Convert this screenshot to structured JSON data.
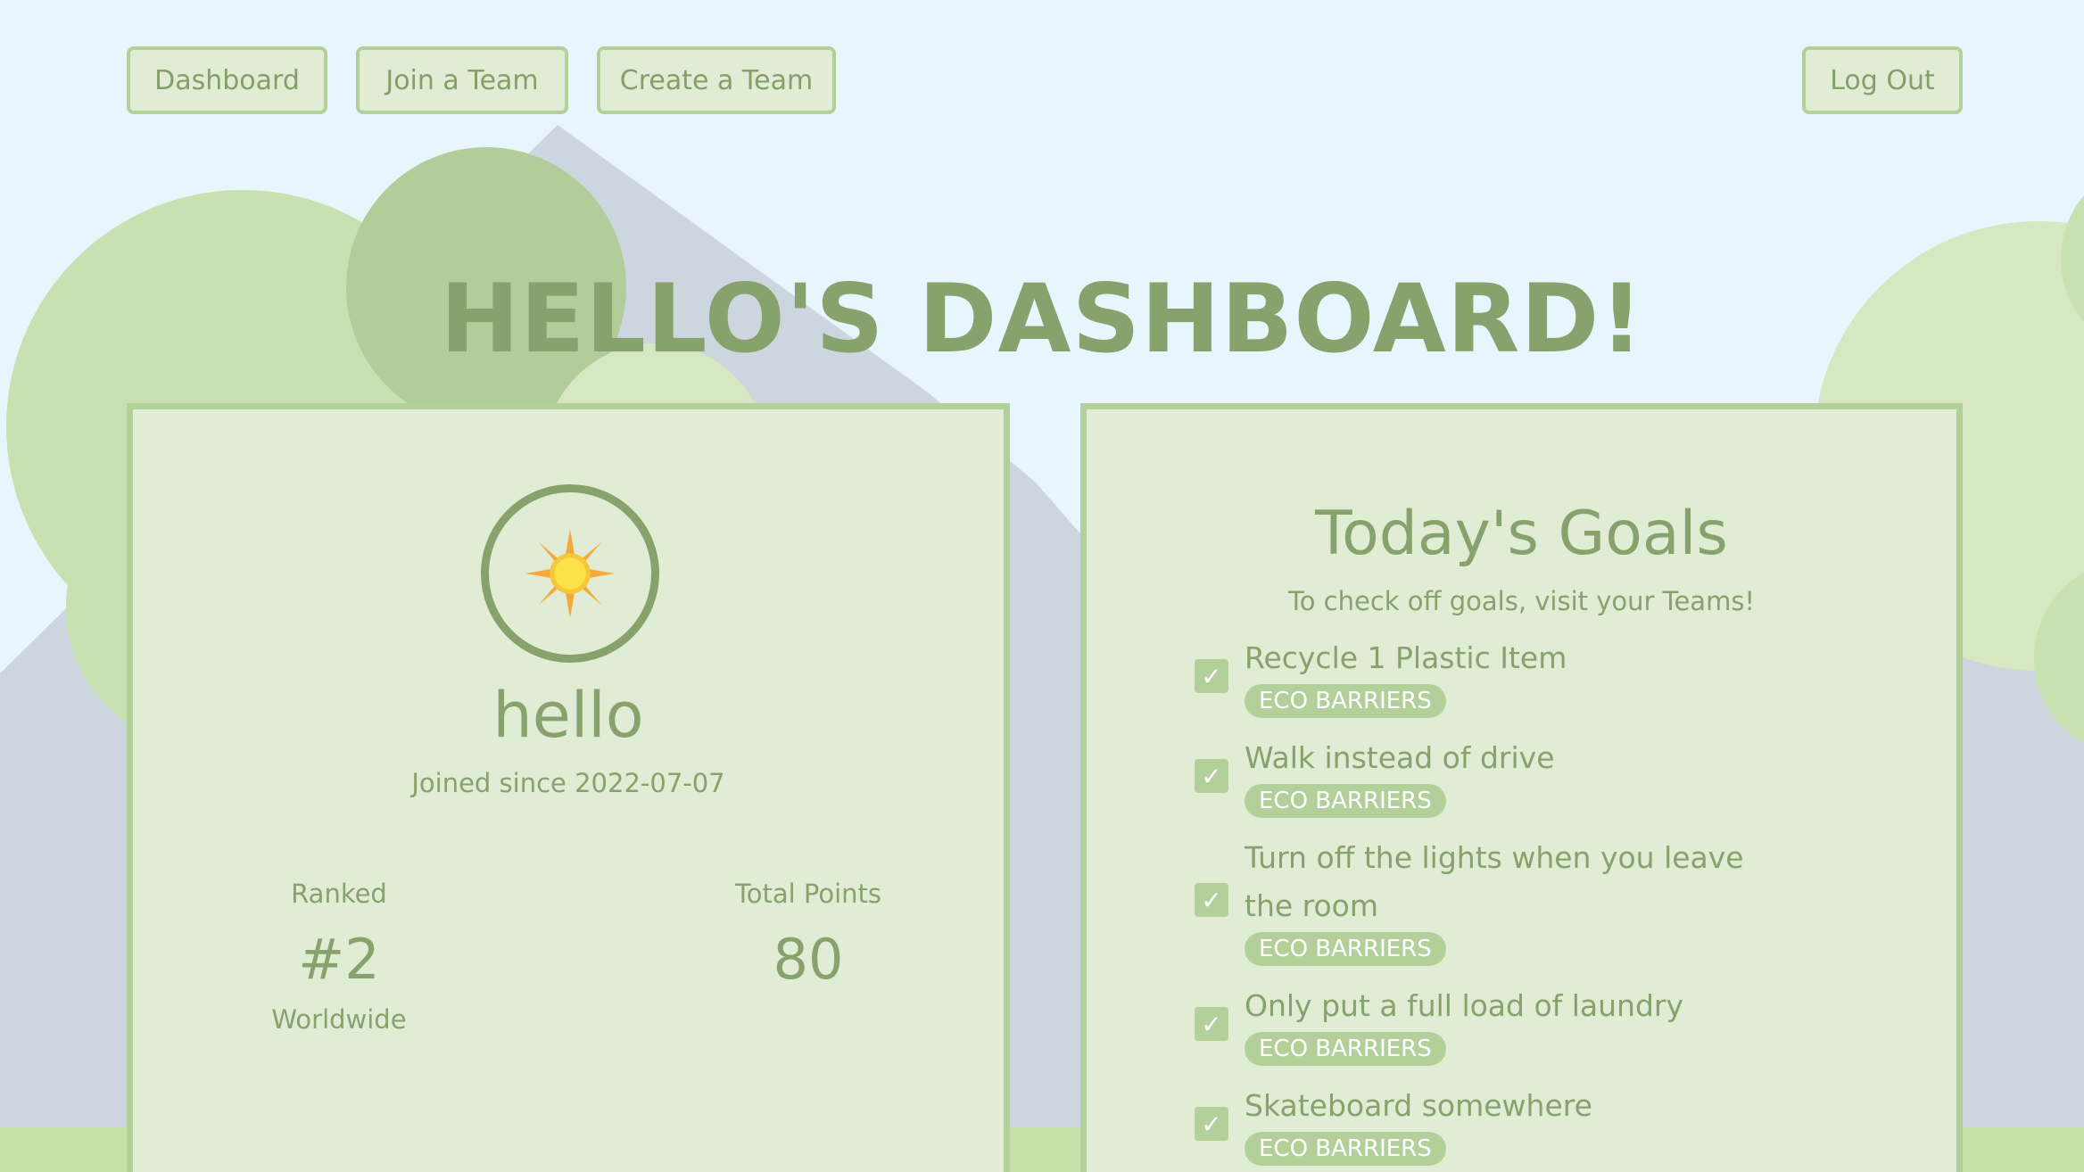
{
  "nav": {
    "dashboard": "Dashboard",
    "join_team": "Join a Team",
    "create_team": "Create a Team",
    "logout": "Log Out"
  },
  "page": {
    "title": "HELLO'S DASHBOARD!"
  },
  "profile": {
    "avatar_icon": "sun-icon",
    "username": "hello",
    "joined": "Joined since 2022-07-07",
    "rank_label": "Ranked",
    "rank_value": "#2",
    "rank_scope": "Worldwide",
    "points_label": "Total Points",
    "points_value": "80"
  },
  "goals": {
    "title": "Today's Goals",
    "subtitle": "To check off goals, visit your Teams!",
    "items": [
      {
        "text": "Recycle 1 Plastic Item",
        "team": "ECO BARRIERS",
        "checked": true
      },
      {
        "text": "Walk instead of drive",
        "team": "ECO BARRIERS",
        "checked": true
      },
      {
        "text": "Turn off the lights when you leave the room",
        "team": "ECO BARRIERS",
        "checked": true
      },
      {
        "text": "Only put a full load of laundry",
        "team": "ECO BARRIERS",
        "checked": true
      },
      {
        "text": "Skateboard somewhere",
        "team": "ECO BARRIERS",
        "checked": true
      }
    ]
  },
  "colors": {
    "accent": "#87a26c",
    "border": "#b3d09a",
    "card_bg": "#e1ecd4",
    "sky": "#e8f5fd",
    "mountain": "#cdd6df"
  }
}
